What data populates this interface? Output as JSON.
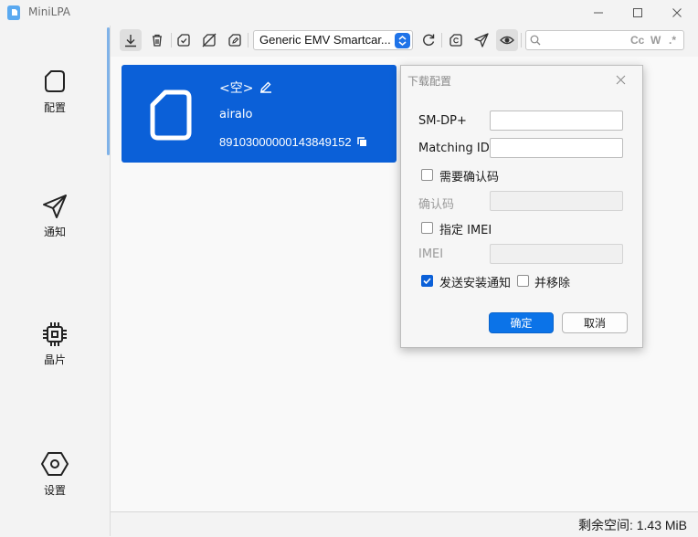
{
  "window": {
    "title": "MiniLPA"
  },
  "sidebar": {
    "items": [
      {
        "label": "配置",
        "icon": "sim-card-icon"
      },
      {
        "label": "通知",
        "icon": "send-icon"
      },
      {
        "label": "晶片",
        "icon": "chip-icon"
      },
      {
        "label": "设置",
        "icon": "hexagon-settings-icon"
      }
    ]
  },
  "toolbar": {
    "reader_select": "Generic EMV Smartcar...",
    "search_placeholder": "",
    "search_options": [
      "Cc",
      "W",
      ".*"
    ]
  },
  "profile": {
    "name": "<空>",
    "provider": "airalo",
    "iccid": "89103000000143849152"
  },
  "dialog": {
    "title": "下载配置",
    "fields": {
      "smdp_label": "SM-DP+",
      "smdp_value": "",
      "matching_id_label": "Matching ID",
      "matching_id_value": "",
      "require_confirm_label": "需要确认码",
      "confirm_code_label": "确认码",
      "specify_imei_label": "指定 IMEI",
      "imei_label": "IMEI",
      "send_notification_label": "发送安装通知",
      "and_remove_label": "并移除"
    },
    "checkboxes": {
      "require_confirm": false,
      "specify_imei": false,
      "send_notification": true,
      "and_remove": false
    },
    "ok_label": "确定",
    "cancel_label": "取消"
  },
  "status": {
    "storage": "剩余空间: 1.43 MiB"
  },
  "colors": {
    "accent": "#0b60d8",
    "profile_card": "#0b60d8"
  }
}
